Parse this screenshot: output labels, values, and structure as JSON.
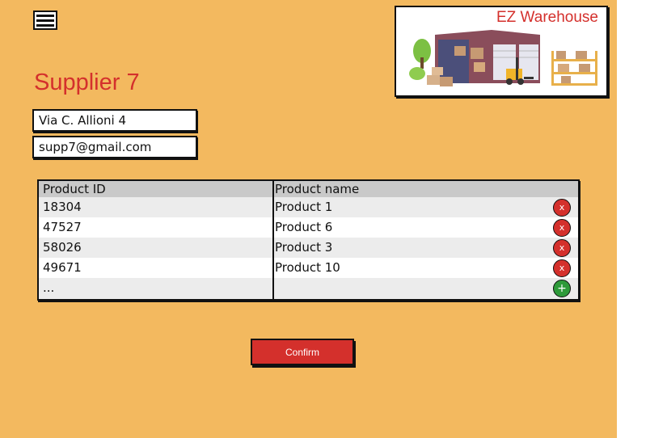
{
  "brand": {
    "name": "EZ Warehouse",
    "color": "#d4302c"
  },
  "header": {
    "menu_icon": "hamburger-menu-icon"
  },
  "supplier": {
    "title": "Supplier 7",
    "address": "Via C. Allioni 4",
    "email": "supp7@gmail.com"
  },
  "table": {
    "columns": [
      "Product ID",
      "Product name"
    ],
    "rows": [
      {
        "id": "18304",
        "name": "Product 1",
        "action": "x"
      },
      {
        "id": "47527",
        "name": "Product 6",
        "action": "x"
      },
      {
        "id": "58026",
        "name": "Product 3",
        "action": "x"
      },
      {
        "id": "49671",
        "name": "Product 10",
        "action": "x"
      }
    ],
    "more": {
      "id": "...",
      "action": "+"
    }
  },
  "actions": {
    "confirm_label": "Confirm"
  },
  "colors": {
    "background": "#f3b95f",
    "accent": "#d4302c",
    "add": "#2e9a3a"
  }
}
